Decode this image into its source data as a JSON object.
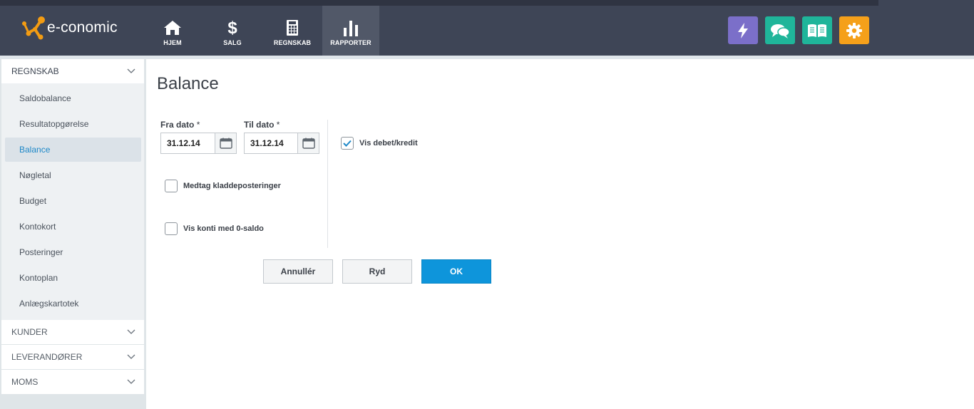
{
  "app": {
    "logo_text": "e-conomic"
  },
  "nav": [
    {
      "label": "HJEM",
      "icon": "home-icon"
    },
    {
      "label": "SALG",
      "icon": "dollar-icon"
    },
    {
      "label": "REGNSKAB",
      "icon": "calculator-icon"
    },
    {
      "label": "RAPPORTER",
      "icon": "bar-chart-icon",
      "active": true
    }
  ],
  "tools": [
    {
      "icon": "lightning-icon",
      "color": "#7b6fc9"
    },
    {
      "icon": "chat-icon",
      "color": "#1fb59a"
    },
    {
      "icon": "book-icon",
      "color": "#1fb59a"
    },
    {
      "icon": "gear-icon",
      "color": "#f5a01a"
    }
  ],
  "sidebar": {
    "groups": [
      {
        "label": "REGNSKAB",
        "open": true,
        "items": [
          {
            "label": "Saldobalance"
          },
          {
            "label": "Resultatopgørelse"
          },
          {
            "label": "Balance",
            "active": true
          },
          {
            "label": "Nøgletal"
          },
          {
            "label": "Budget"
          },
          {
            "label": "Kontokort"
          },
          {
            "label": "Posteringer"
          },
          {
            "label": "Kontoplan"
          },
          {
            "label": "Anlægskartotek"
          }
        ]
      },
      {
        "label": "KUNDER"
      },
      {
        "label": "LEVERANDØRER"
      },
      {
        "label": "MOMS"
      }
    ]
  },
  "main": {
    "title": "Balance",
    "from_date": {
      "label": "Fra dato",
      "required_mark": "*",
      "value": "31.12.14"
    },
    "to_date": {
      "label": "Til dato",
      "required_mark": "*",
      "value": "31.12.14"
    },
    "checks": {
      "include_drafts": {
        "label": "Medtag kladdeposteringer",
        "checked": false
      },
      "zero_accounts": {
        "label": "Vis konti med 0-saldo",
        "checked": false
      },
      "debit_credit": {
        "label": "Vis debet/kredit",
        "checked": true
      }
    },
    "buttons": {
      "cancel": "Annullér",
      "clear": "Ryd",
      "ok": "OK"
    }
  },
  "colors": {
    "accent": "#0e95db",
    "active_link": "#1e88c8",
    "topbar": "#3e4556"
  }
}
